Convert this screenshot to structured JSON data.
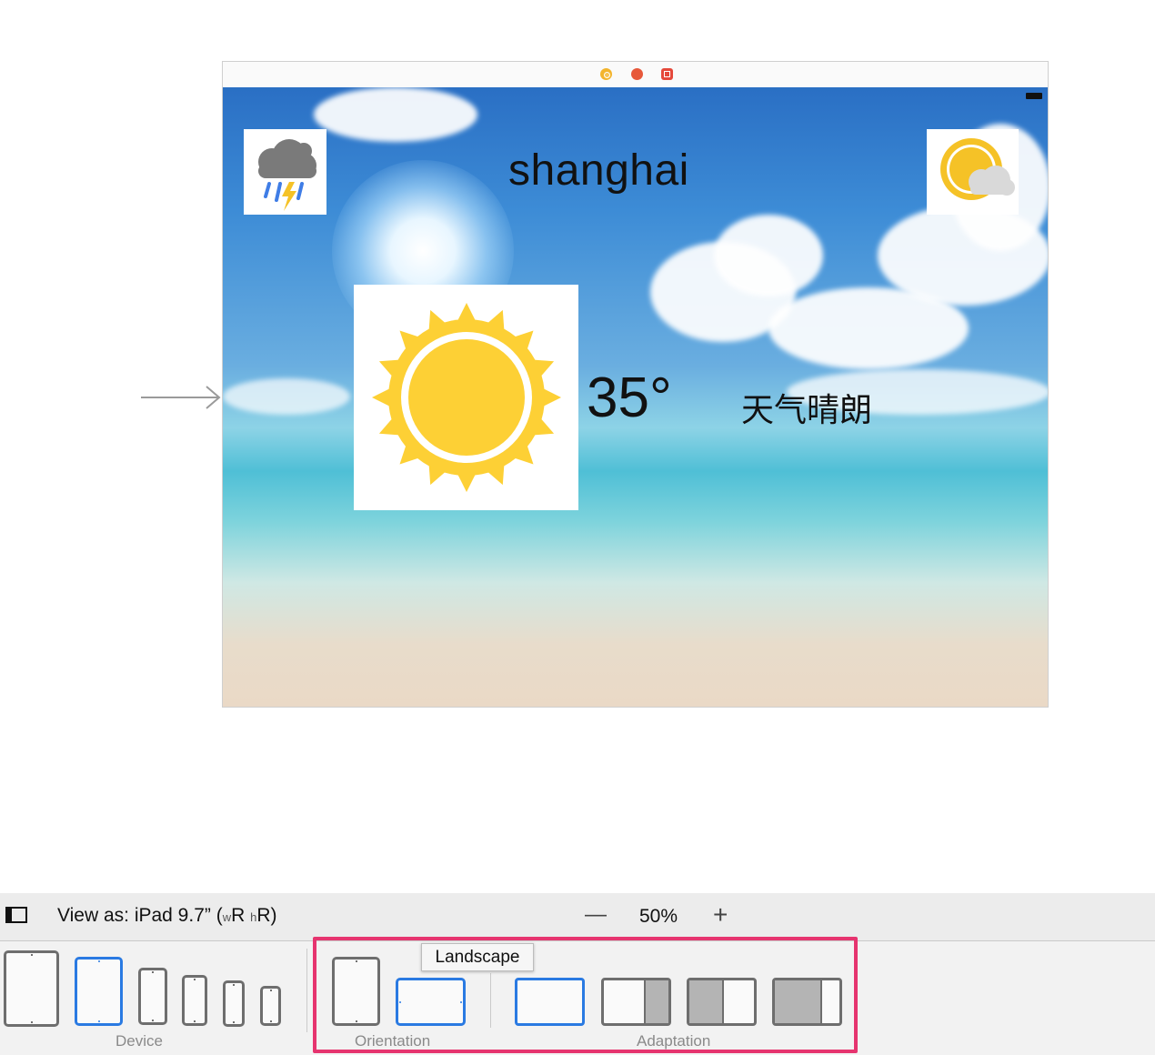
{
  "scene": {
    "city": "shanghai",
    "temperature": "35°",
    "description": "天气晴朗",
    "icons": [
      "thunderstorm-icon",
      "partly-cloudy-icon",
      "sunny-icon"
    ],
    "dock_icons": [
      "view-controller-icon",
      "first-responder-icon",
      "exit-icon"
    ]
  },
  "toolbar": {
    "view_as": "View as: iPad 9.7” (",
    "w_small": "w",
    "w_cap": "R ",
    "h_small": "h",
    "h_cap": "R)",
    "zoom_minus": "—",
    "zoom_value": "50%",
    "zoom_plus": "+"
  },
  "config": {
    "device_label": "Device",
    "orientation_label": "Orientation",
    "adaptation_label": "Adaptation",
    "tooltip": "Landscape"
  },
  "colors": {
    "selected": "#2a7ae2",
    "highlight": "#e6346f",
    "sun": "#fdd035"
  }
}
